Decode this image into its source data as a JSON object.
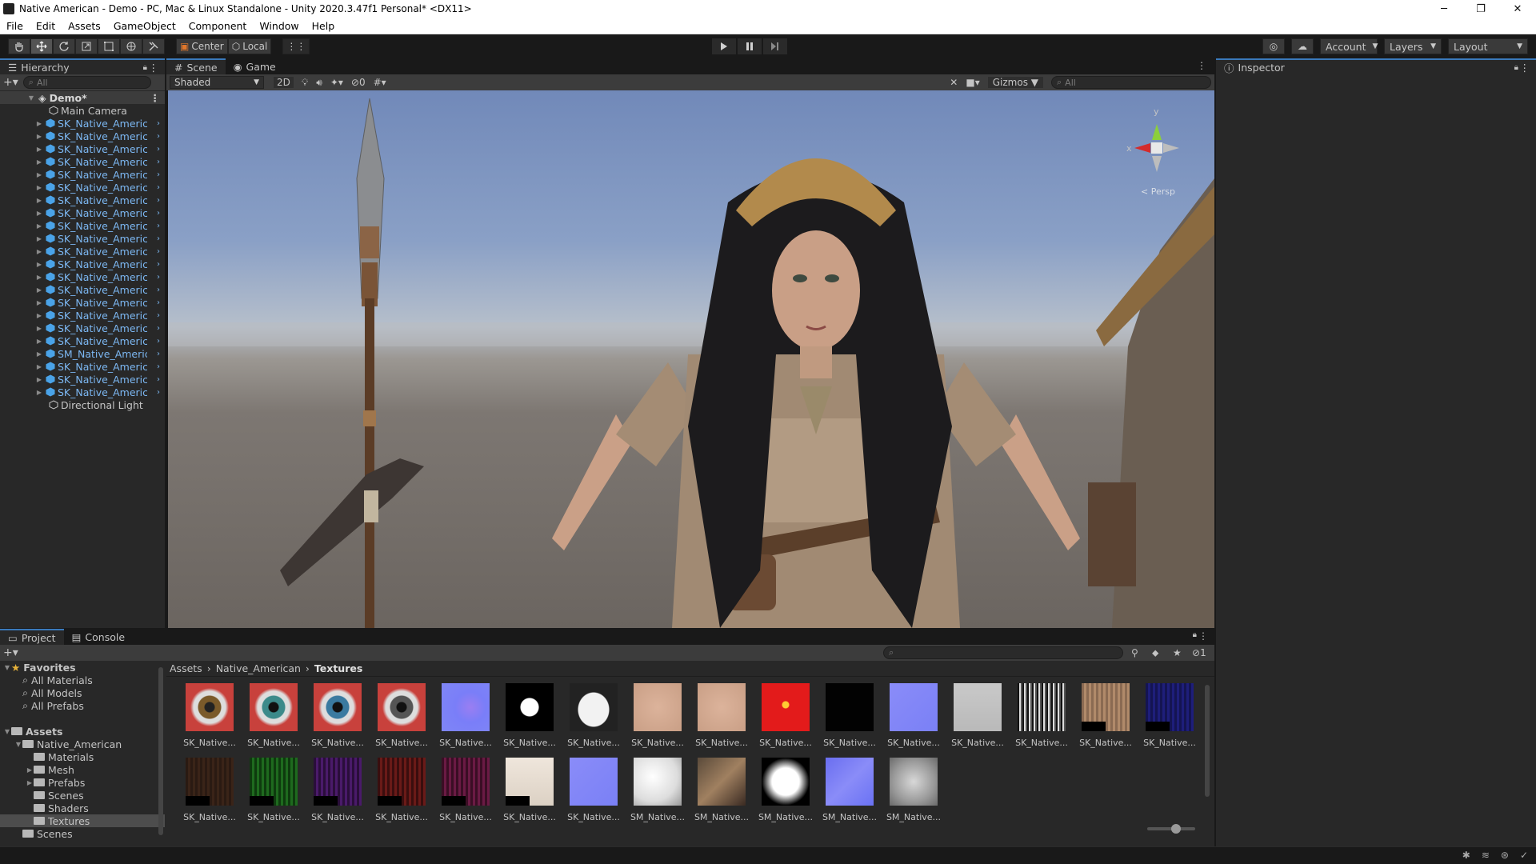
{
  "window": {
    "title": "Native American - Demo - PC, Mac & Linux Standalone - Unity 2020.3.47f1 Personal* <DX11>",
    "min": "─",
    "max": "❐",
    "close": "✕"
  },
  "menu": [
    "File",
    "Edit",
    "Assets",
    "GameObject",
    "Component",
    "Window",
    "Help"
  ],
  "toolbar": {
    "pivot": "Center",
    "space": "Local",
    "account": "Account",
    "layers": "Layers",
    "layout": "Layout"
  },
  "hierarchy": {
    "tab": "Hierarchy",
    "search_placeholder": "All",
    "root": "Demo*",
    "items": [
      {
        "label": "Main Camera",
        "prefab": false
      },
      {
        "label": "SK_Native_American",
        "prefab": true
      },
      {
        "label": "SK_Native_American",
        "prefab": true
      },
      {
        "label": "SK_Native_American",
        "prefab": true
      },
      {
        "label": "SK_Native_American",
        "prefab": true
      },
      {
        "label": "SK_Native_American",
        "prefab": true
      },
      {
        "label": "SK_Native_American",
        "prefab": true
      },
      {
        "label": "SK_Native_American",
        "prefab": true
      },
      {
        "label": "SK_Native_American",
        "prefab": true
      },
      {
        "label": "SK_Native_American",
        "prefab": true
      },
      {
        "label": "SK_Native_American",
        "prefab": true
      },
      {
        "label": "SK_Native_American",
        "prefab": true
      },
      {
        "label": "SK_Native_American",
        "prefab": true
      },
      {
        "label": "SK_Native_American",
        "prefab": true
      },
      {
        "label": "SK_Native_American",
        "prefab": true
      },
      {
        "label": "SK_Native_American",
        "prefab": true
      },
      {
        "label": "SK_Native_American",
        "prefab": true
      },
      {
        "label": "SK_Native_American",
        "prefab": true
      },
      {
        "label": "SK_Native_American",
        "prefab": true
      },
      {
        "label": "SM_Native_American",
        "prefab": true
      },
      {
        "label": "SK_Native_American",
        "prefab": true
      },
      {
        "label": "SK_Native_American",
        "prefab": true
      },
      {
        "label": "SK_Native_American",
        "prefab": true
      },
      {
        "label": "Directional Light",
        "prefab": false
      }
    ]
  },
  "scene": {
    "tab_scene": "Scene",
    "tab_game": "Game",
    "shading": "Shaded",
    "mode2d": "2D",
    "hidden_count": "0",
    "gizmos": "Gizmos",
    "search_placeholder": "All",
    "gizmo_y": "y",
    "gizmo_x": "x",
    "persp": "Persp"
  },
  "inspector": {
    "tab": "Inspector"
  },
  "project": {
    "tab_project": "Project",
    "tab_console": "Console",
    "hidden_count": "1",
    "breadcrumb": [
      "Assets",
      "Native_American",
      "Textures"
    ],
    "tree": [
      {
        "label": "Favorites",
        "level": 0,
        "type": "star",
        "fold": "▼",
        "bold": true
      },
      {
        "label": "All Materials",
        "level": 1,
        "type": "search"
      },
      {
        "label": "All Models",
        "level": 1,
        "type": "search"
      },
      {
        "label": "All Prefabs",
        "level": 1,
        "type": "search"
      },
      {
        "label": "",
        "level": 0,
        "type": "blank"
      },
      {
        "label": "Assets",
        "level": 0,
        "type": "folder",
        "fold": "▼",
        "bold": true
      },
      {
        "label": "Native_American",
        "level": 1,
        "type": "folder",
        "fold": "▼"
      },
      {
        "label": "Materials",
        "level": 2,
        "type": "folder"
      },
      {
        "label": "Mesh",
        "level": 2,
        "type": "folder",
        "fold": "▶"
      },
      {
        "label": "Prefabs",
        "level": 2,
        "type": "folder",
        "fold": "▶"
      },
      {
        "label": "Scenes",
        "level": 2,
        "type": "folder"
      },
      {
        "label": "Shaders",
        "level": 2,
        "type": "folder"
      },
      {
        "label": "Textures",
        "level": 2,
        "type": "folder",
        "selected": true
      },
      {
        "label": "Scenes",
        "level": 1,
        "type": "folder"
      }
    ],
    "assets": [
      {
        "label": "SK_Native...",
        "style": "eye-brown"
      },
      {
        "label": "SK_Native...",
        "style": "eye-teal"
      },
      {
        "label": "SK_Native...",
        "style": "eye-blue"
      },
      {
        "label": "SK_Native...",
        "style": "eye-gray"
      },
      {
        "label": "SK_Native...",
        "style": "normal-purple"
      },
      {
        "label": "SK_Native...",
        "style": "black-dot"
      },
      {
        "label": "SK_Native...",
        "style": "white-face"
      },
      {
        "label": "SK_Native...",
        "style": "skin-face"
      },
      {
        "label": "SK_Native...",
        "style": "skin-face"
      },
      {
        "label": "SK_Native...",
        "style": "red-face"
      },
      {
        "label": "SK_Native...",
        "style": "black"
      },
      {
        "label": "SK_Native...",
        "style": "normal-blue"
      },
      {
        "label": "SK_Native...",
        "style": "gray-face"
      },
      {
        "label": "SK_Native...",
        "style": "hair-bw"
      },
      {
        "label": "SK_Native...",
        "style": "hair-brown"
      },
      {
        "label": "SK_Native...",
        "style": "hair-navy"
      },
      {
        "label": "SK_Native...",
        "style": "hair-dark-brown"
      },
      {
        "label": "SK_Native...",
        "style": "hair-green"
      },
      {
        "label": "SK_Native...",
        "style": "hair-purple"
      },
      {
        "label": "SK_Native...",
        "style": "hair-red"
      },
      {
        "label": "SK_Native...",
        "style": "hair-magenta"
      },
      {
        "label": "SK_Native...",
        "style": "cream"
      },
      {
        "label": "SK_Native...",
        "style": "normal-blue"
      },
      {
        "label": "SM_Native...",
        "style": "white-map"
      },
      {
        "label": "SM_Native...",
        "style": "brown-map"
      },
      {
        "label": "SM_Native...",
        "style": "white-black-map"
      },
      {
        "label": "SM_Native...",
        "style": "normal-map"
      },
      {
        "label": "SM_Native...",
        "style": "gray-map"
      }
    ]
  },
  "colors": {
    "accent": "#3a79bb",
    "prefab_text": "#7cb7f2",
    "panel_bg": "#282828",
    "toolbar_bg": "#191919"
  }
}
